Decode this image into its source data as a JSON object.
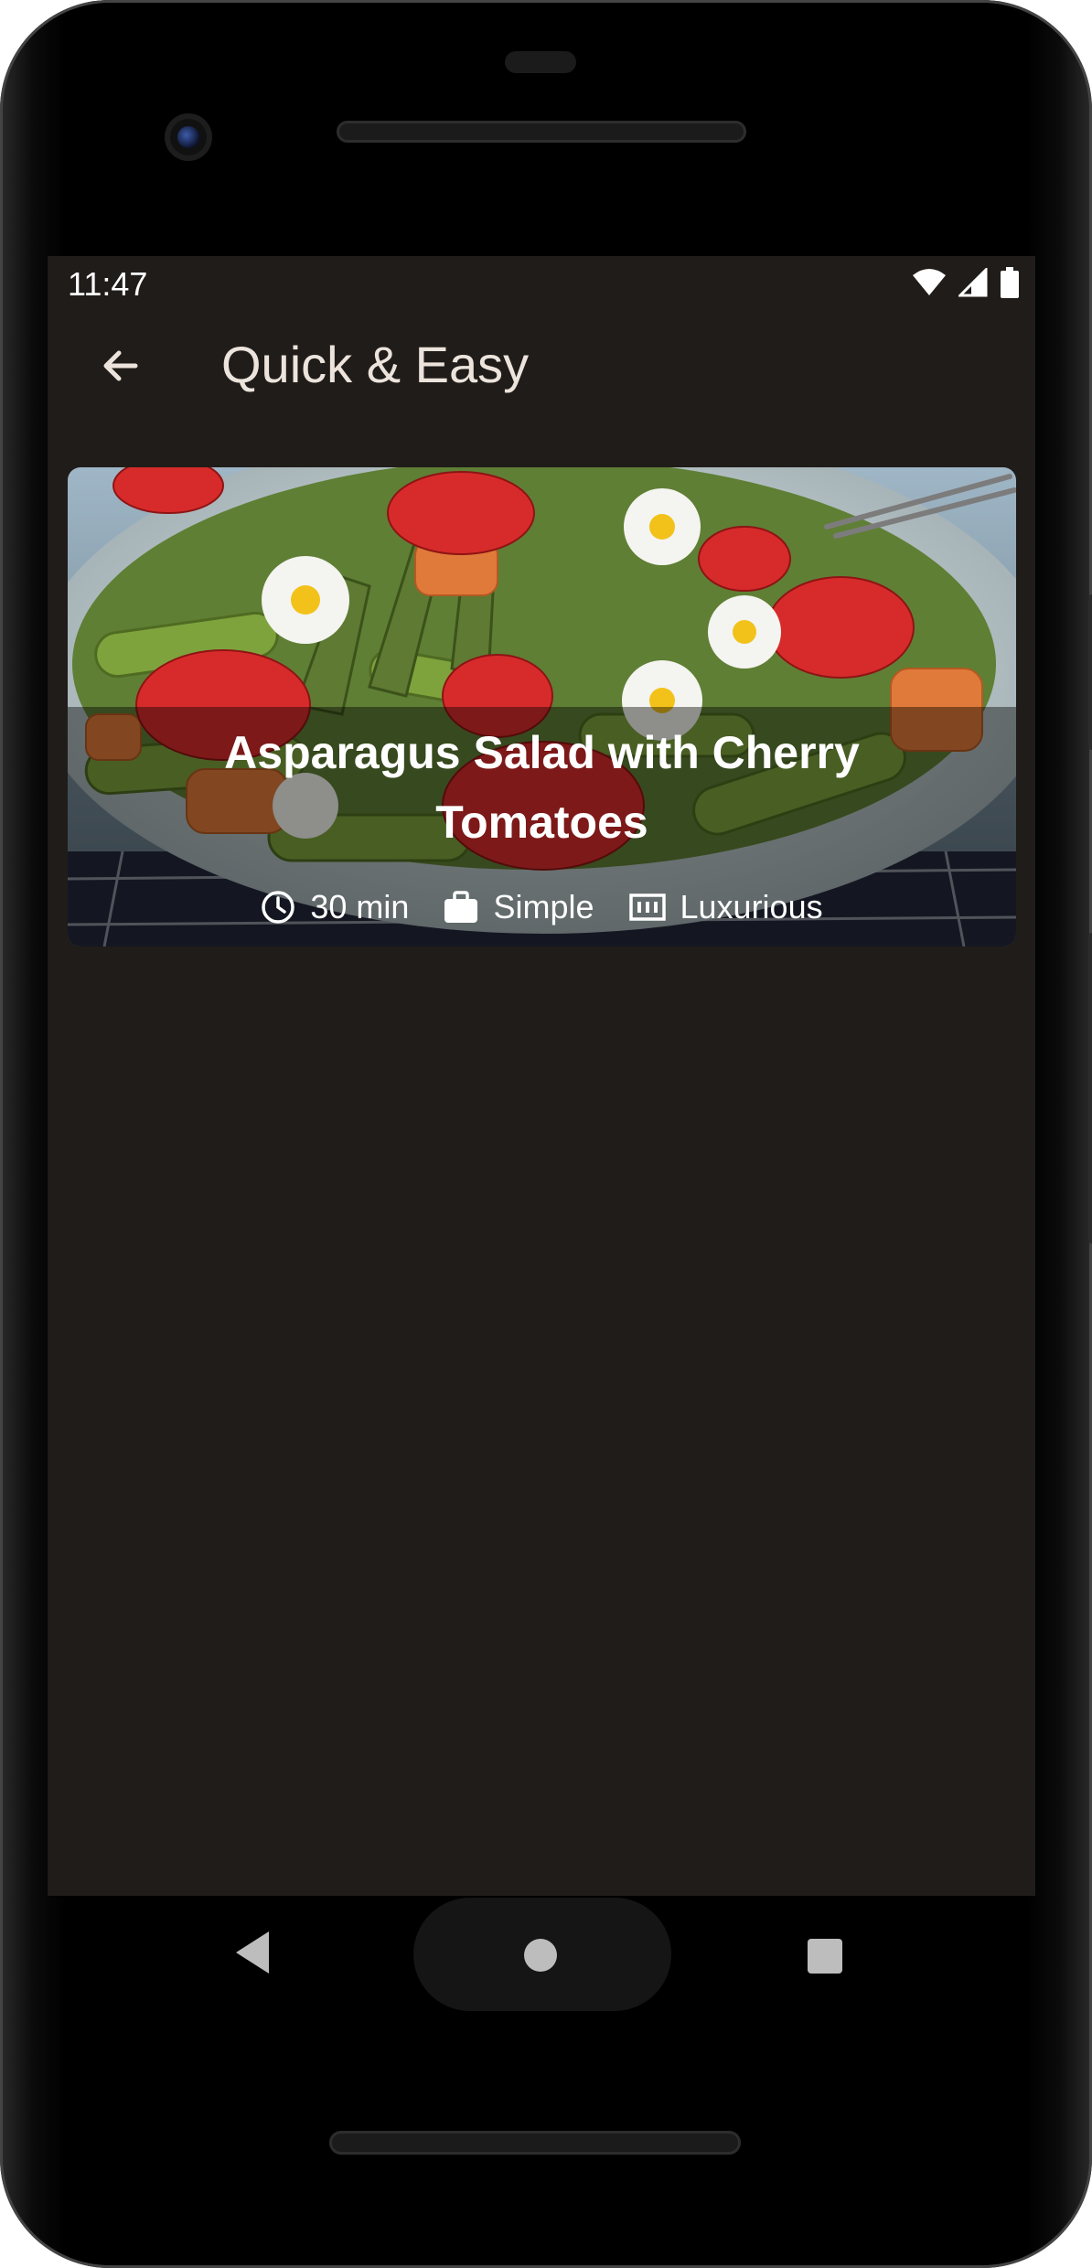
{
  "status_bar": {
    "time": "11:47",
    "icons": [
      "wifi-icon",
      "signal-icon",
      "battery-icon"
    ]
  },
  "app_bar": {
    "back_icon": "arrow-back-icon",
    "title": "Quick & Easy"
  },
  "meals": [
    {
      "title": "Asparagus Salad with Cherry Tomatoes",
      "duration": "30 min",
      "complexity": "Simple",
      "affordability": "Luxurious",
      "icons": [
        "clock-icon",
        "briefcase-icon",
        "money-icon"
      ]
    }
  ],
  "nav_bar": {
    "icons": [
      "nav-back-icon",
      "nav-home-icon",
      "nav-recents-icon"
    ]
  },
  "colors": {
    "background": "#201c19",
    "title_text": "#ece4dc",
    "overlay": "rgba(0,0,0,0.42)"
  }
}
